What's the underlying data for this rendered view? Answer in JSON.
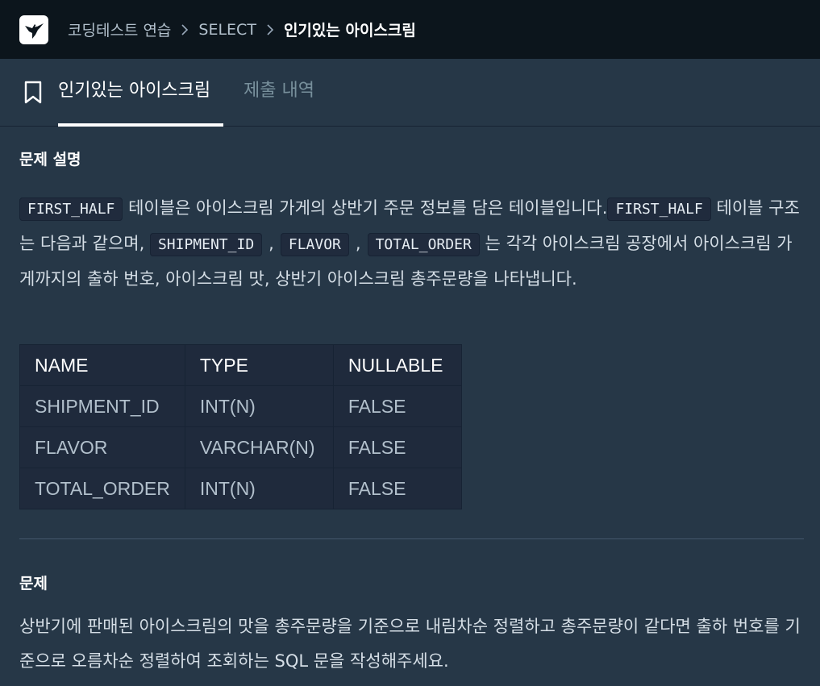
{
  "breadcrumb": {
    "items": [
      "코딩테스트 연습",
      "SELECT",
      "인기있는 아이스크림"
    ]
  },
  "tabs": {
    "active": "인기있는 아이스크림",
    "inactive": "제출 내역"
  },
  "description": {
    "title": "문제 설명",
    "code_first_half": "FIRST_HALF",
    "text_1": "테이블은 아이스크림 가게의 상반기 주문 정보를 담은 테이블입니다.",
    "text_2": "테이블 구조는 다음과 같으며,",
    "code_shipment_id": "SHIPMENT_ID",
    "code_flavor": "FLAVOR",
    "code_total_order": "TOTAL_ORDER",
    "comma": ",",
    "text_3": "는 각각 아이스크림 공장에서 아이스크림 가게까지의 출하 번호, 아이스크림 맛, 상반기 아이스크림 총주문량을 나타냅니다."
  },
  "schema_table": {
    "headers": [
      "NAME",
      "TYPE",
      "NULLABLE"
    ],
    "rows": [
      [
        "SHIPMENT_ID",
        "INT(N)",
        "FALSE"
      ],
      [
        "FLAVOR",
        "VARCHAR(N)",
        "FALSE"
      ],
      [
        "TOTAL_ORDER",
        "INT(N)",
        "FALSE"
      ]
    ]
  },
  "problem": {
    "title": "문제",
    "text": "상반기에 판매된 아이스크림의 맛을 총주문량을 기준으로 내림차순 정렬하고 총주문량이 같다면 출하 번호를 기준으로 오름차순 정렬하여 조회하는 SQL 문을 작성해주세요."
  },
  "colors": {
    "background": "#263747",
    "topbar": "#0c151c",
    "code_background": "#202b3d"
  }
}
